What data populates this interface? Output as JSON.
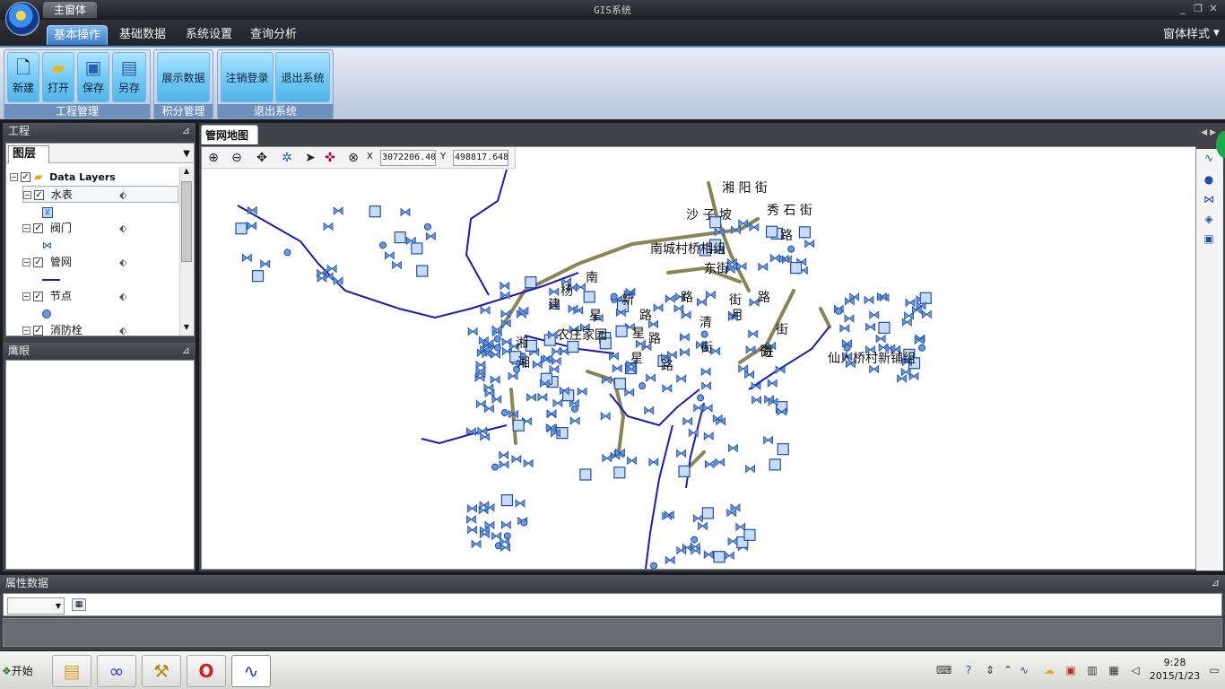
{
  "window": {
    "app_tab": "主窗体",
    "title": "GIS系统",
    "controls": [
      "_",
      "❐",
      "✕"
    ]
  },
  "menu": {
    "tabs": [
      "基本操作",
      "基础数据",
      "系统设置",
      "查询分析"
    ],
    "active_tab": "基本操作",
    "style_label": "窗体样式"
  },
  "ribbon": {
    "groups": [
      {
        "title": "工程管理",
        "buttons": [
          "新建",
          "打开",
          "保存",
          "另存"
        ]
      },
      {
        "title": "积分管理",
        "buttons": [
          "展示数据"
        ]
      },
      {
        "title": "退出系统",
        "buttons": [
          "注销登录",
          "退出系统"
        ]
      }
    ]
  },
  "left_panel": {
    "title": "工程",
    "layers_tab": "图层",
    "root": "Data Layers",
    "layers": [
      {
        "name": "水表",
        "checked": true,
        "symbol": "water-meter-icon"
      },
      {
        "name": "阀门",
        "checked": true,
        "symbol": "valve-icon"
      },
      {
        "name": "管网",
        "checked": true,
        "symbol": "pipe-line"
      },
      {
        "name": "节点",
        "checked": true,
        "symbol": "node-dot"
      },
      {
        "name": "消防栓",
        "checked": true,
        "symbol": "hydrant-icon"
      }
    ],
    "eagle_title": "鹰眼"
  },
  "map": {
    "tab": "管网地图",
    "coord_x_label": "X",
    "coord_x": "3072206.40",
    "coord_y_label": "Y",
    "coord_y": "498817.648",
    "labels": [
      "湘 阳 街",
      "秀 石 街",
      "沙 子 坡",
      "路",
      "南城村桥相组",
      "东街",
      "南",
      "杨",
      "建",
      "新",
      "路",
      "路",
      "街",
      "路",
      "星",
      "路",
      "星",
      "清",
      "月",
      "街",
      "湘",
      "湘",
      "农庄家园",
      "街",
      "星",
      "路",
      "街",
      "进",
      "仙人桥村新铺组"
    ]
  },
  "attribute_panel": {
    "title": "属性数据"
  },
  "taskbar": {
    "start": "开始",
    "time": "9:28",
    "date": "2015/1/23"
  },
  "colors": {
    "accent": "#3a7bc8",
    "pipe": "#1a1ab5",
    "road": "#8b8455",
    "titlebar": "#2c2d34"
  }
}
